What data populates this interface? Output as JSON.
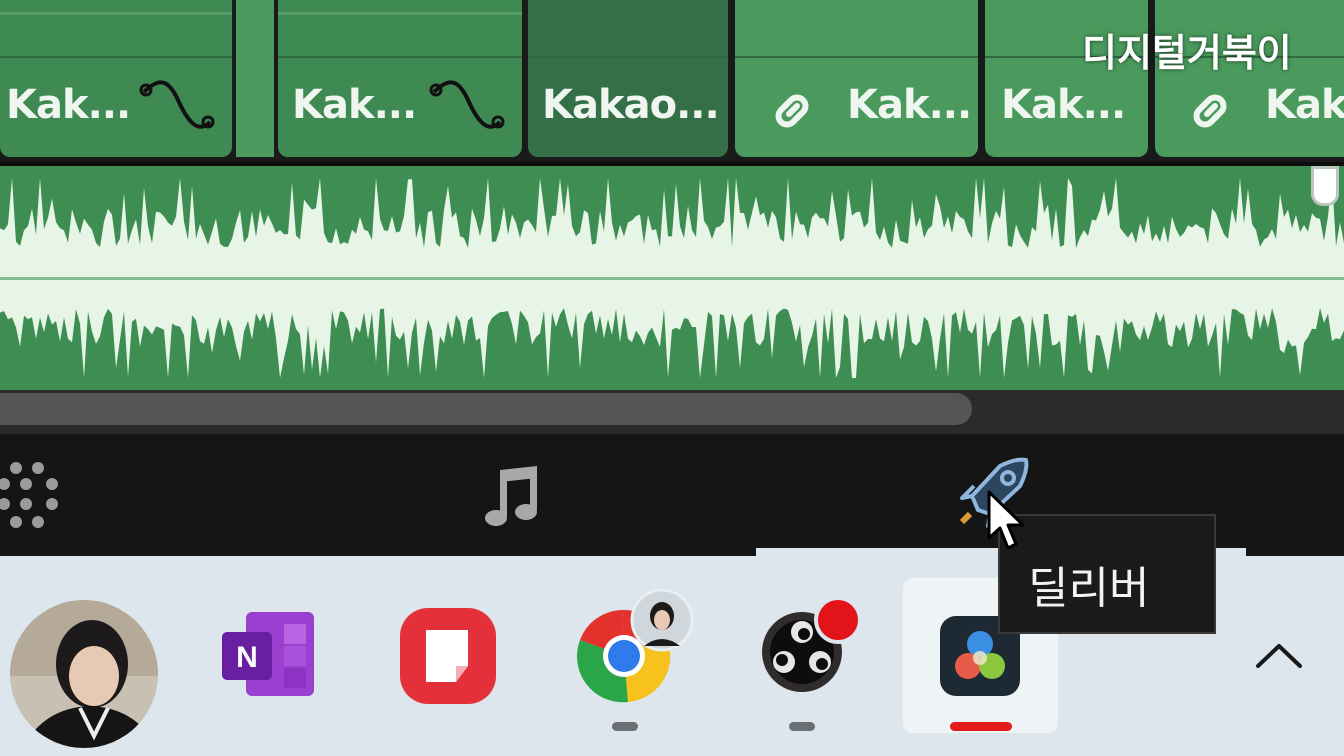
{
  "watermark": "디지털거북이",
  "clips": [
    {
      "label": "Kak...",
      "icon": "keyframe-curve-icon",
      "shade": "normal"
    },
    {
      "label": "Kak...",
      "icon": "keyframe-curve-icon",
      "shade": "normal"
    },
    {
      "label": "Kakao...",
      "icon": "",
      "shade": "dark"
    },
    {
      "label": "Kak...",
      "icon": "link-icon",
      "shade": "light"
    },
    {
      "label": "Kak...",
      "icon": "",
      "shade": "light"
    },
    {
      "label": "Kak",
      "icon": "link-icon",
      "shade": "light"
    }
  ],
  "page_bar": {
    "items": [
      "fusion-dots-icon",
      "fairlight-music-icon",
      "deliver-rocket-icon"
    ]
  },
  "tooltip": {
    "text": "딜리버"
  },
  "taskbar": {
    "items": [
      {
        "name": "onenote-icon",
        "letter": "N"
      },
      {
        "name": "notes-icon"
      },
      {
        "name": "chrome-icon",
        "running": true
      },
      {
        "name": "obs-icon",
        "running": true,
        "recording": true
      },
      {
        "name": "davinci-resolve-icon",
        "active": true
      }
    ],
    "overflow": "chevron-up-icon"
  },
  "colors": {
    "clip_green": "#3f8a52",
    "wave_fill": "#e6f5e6",
    "active_indicator": "#e21b1b"
  }
}
